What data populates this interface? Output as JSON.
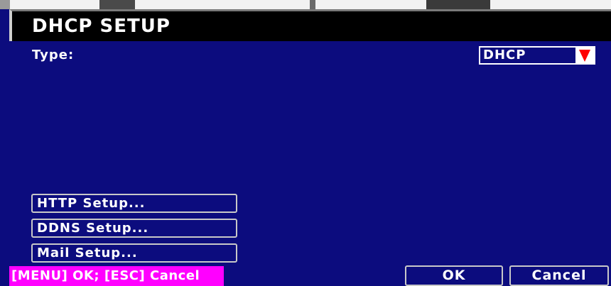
{
  "dialog": {
    "title": "DHCP SETUP"
  },
  "type_field": {
    "label": "Type:",
    "value": "DHCP"
  },
  "setup_buttons": [
    {
      "label": "HTTP Setup..."
    },
    {
      "label": "DDNS Setup..."
    },
    {
      "label": "Mail Setup..."
    }
  ],
  "footer": {
    "hint": "[MENU] OK; [ESC] Cancel",
    "ok_label": "OK",
    "cancel_label": "Cancel"
  },
  "colors": {
    "background": "#0c0c7e",
    "title_bar": "#000000",
    "hint_bar": "#ff00ff",
    "dropdown_arrow": "#ff0000",
    "text": "#ffffff"
  },
  "icons": {
    "dropdown": "triangle-down-icon"
  }
}
